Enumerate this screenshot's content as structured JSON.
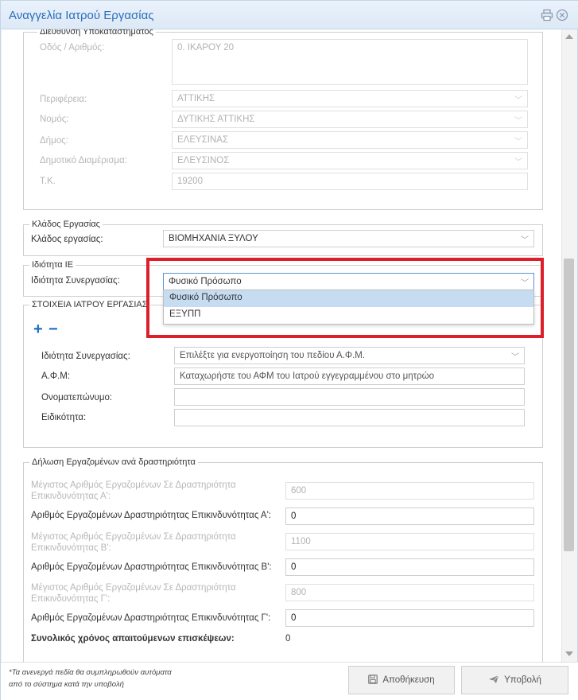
{
  "window": {
    "title": "Αναγγελία Ιατρού Εργασίας"
  },
  "address": {
    "legend": "Διεύθυνση Υποκαταστήματος",
    "street_label": "Οδός / Αριθμός:",
    "street_value": "0. ΙΚΑΡΟΥ 20",
    "region_label": "Περιφέρεια:",
    "region_value": "ΑΤΤΙΚΗΣ",
    "prefecture_label": "Νομός:",
    "prefecture_value": "ΔΥΤΙΚΗΣ ΑΤΤΙΚΗΣ",
    "municipality_label": "Δήμος:",
    "municipality_value": "ΕΛΕΥΣΙΝΑΣ",
    "district_label": "Δημοτικό Διαμέρισμα:",
    "district_value": "ΕΛΕΥΣΙΝΟΣ",
    "postal_label": "Τ.Κ.",
    "postal_value": "19200"
  },
  "sector": {
    "legend": "Κλάδος Εργασίας",
    "label": "Κλάδος εργασίας:",
    "value": "ΒΙΟΜΗΧΑΝΙΑ ΞΥΛΟΥ"
  },
  "ie": {
    "legend": "Ιδιότητα ΙΕ",
    "label": "Ιδιότητα Συνεργασίας:",
    "value": "Φυσικό Πρόσωπο",
    "options": [
      "Φυσικό Πρόσωπο",
      "ΕΞΥΠΠ"
    ]
  },
  "doctor": {
    "legend": "ΣΤΟΙΧΕΙΑ ΙΑΤΡΟΥ ΕΡΓΑΣΙΑΣ",
    "add_symbol": "+",
    "remove_symbol": "−",
    "coop_label": "Ιδιότητα Συνεργασίας:",
    "coop_placeholder": "Επιλέξτε για ενεργοποίηση του πεδίου Α.Φ.Μ.",
    "afm_label": "Α.Φ.Μ:",
    "afm_placeholder": "Καταχωρήστε του ΑΦΜ του Ιατρού εγγεγραμμένου στο μητρώο",
    "name_label": "Ονοματεπώνυμο:",
    "name_value": "",
    "specialty_label": "Ειδικότητα:",
    "specialty_value": ""
  },
  "employees": {
    "legend": "Δήλωση Εργαζομένων ανά δραστηριότητα",
    "max_a_label_1": "Μέγιστος Αριθμός Εργαζομένων Σε Δραστηριότητα",
    "max_a_label_2": "Επικινδυνότητας Α':",
    "max_a_value": "600",
    "count_a_label": "Αριθμός Εργαζομένων Δραστηριότητας Επικινδυνότητας Α':",
    "count_a_value": "0",
    "max_b_label_1": "Μέγιστος Αριθμός Εργαζομένων Σε Δραστηριότητα",
    "max_b_label_2": "Επικινδυνότητας Β':",
    "max_b_value": "1100",
    "count_b_label": "Αριθμός Εργαζομένων Δραστηριότητας Επικινδυνότητας Β':",
    "count_b_value": "0",
    "max_c_label_1": "Μέγιστος Αριθμός Εργαζομένων Σε Δραστηριότητα",
    "max_c_label_2": "Επικινδυνότητας Γ':",
    "max_c_value": "800",
    "count_c_label": "Αριθμός Εργαζομένων Δραστηριότητας Επικινδυνότητας Γ':",
    "count_c_value": "0",
    "total_label": "Συνολικός χρόνος απαιτούμενων επισκέψεων:",
    "total_value": "0"
  },
  "footer": {
    "note_1": "*Τα ανενεργά πεδία θα συμπληρωθούν αυτόματα",
    "note_2": "από το σύστημα κατά την υποβολή",
    "save_label": "Αποθήκευση",
    "submit_label": "Υποβολή"
  },
  "colors": {
    "accent": "#2a6ebb",
    "highlight": "#dc1f2a",
    "plus": "#1e6fc2"
  }
}
